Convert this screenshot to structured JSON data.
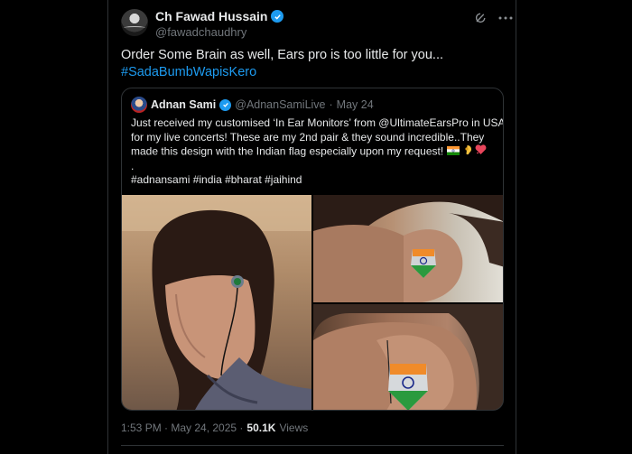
{
  "tweet": {
    "display_name": "Ch Fawad Hussain",
    "handle": "@fawadchaudhry",
    "text": "Order Some Brain as well, Ears pro is too little for you...",
    "hashtag": "#SadaBumbWapisKero",
    "timestamp": "1:53 PM · May 24, 2025 ·",
    "views_count": "50.1K",
    "views_label": "Views"
  },
  "quote": {
    "display_name": "Adnan Sami",
    "handle": "@AdnanSamiLive",
    "separator": "·",
    "date": "May 24",
    "lines": [
      "Just received my customised ‘In Ear Monitors’ from @UltimateEarsPro in USA",
      "for my live concerts! These are my 2nd pair & they sound incredible..They",
      "made this design with the Indian flag especially upon my request!",
      ".",
      "#adnansami #india #bharat #jaihind"
    ]
  },
  "icons": {
    "verified": "verified-badge-icon",
    "grok": "grok-icon",
    "more": "more-icon"
  },
  "colors": {
    "background": "#000000",
    "text": "#e7e9ea",
    "muted": "#71767b",
    "accent": "#1d9bf0",
    "border": "#2f3336"
  }
}
